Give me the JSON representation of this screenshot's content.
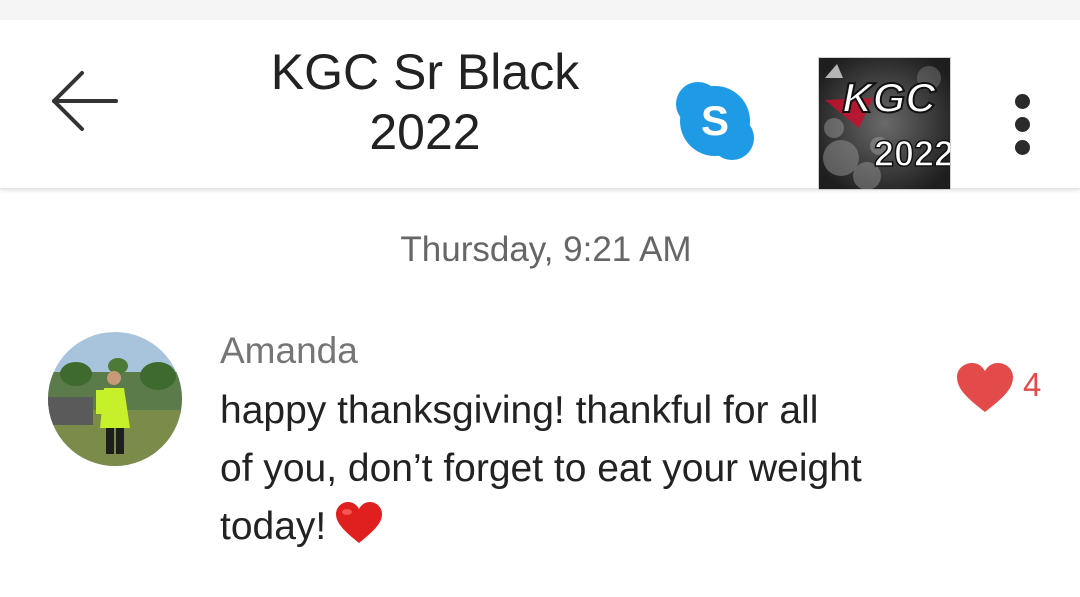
{
  "header": {
    "back_icon": "arrow-left-icon",
    "title_line1": "KGC Sr Black",
    "title_line2": "2022",
    "call_icon": "skype-icon",
    "call_icon_letter": "S",
    "group_avatar": {
      "logo_text": "KGC",
      "year_text": "2022"
    },
    "more_icon": "more-vertical-icon"
  },
  "timestamp": "Thursday, 9:21 AM",
  "message": {
    "sender": "Amanda",
    "lines": [
      "happy thanksgiving! thankful for all",
      "of you, don’t forget to eat your weight",
      "today!"
    ],
    "emoji": "heart-icon",
    "reaction": {
      "icon": "heart-icon",
      "count": "4"
    }
  },
  "colors": {
    "skype_blue": "#1f9be6",
    "reaction_red": "#e34b4b",
    "emoji_red": "#e0201f"
  }
}
